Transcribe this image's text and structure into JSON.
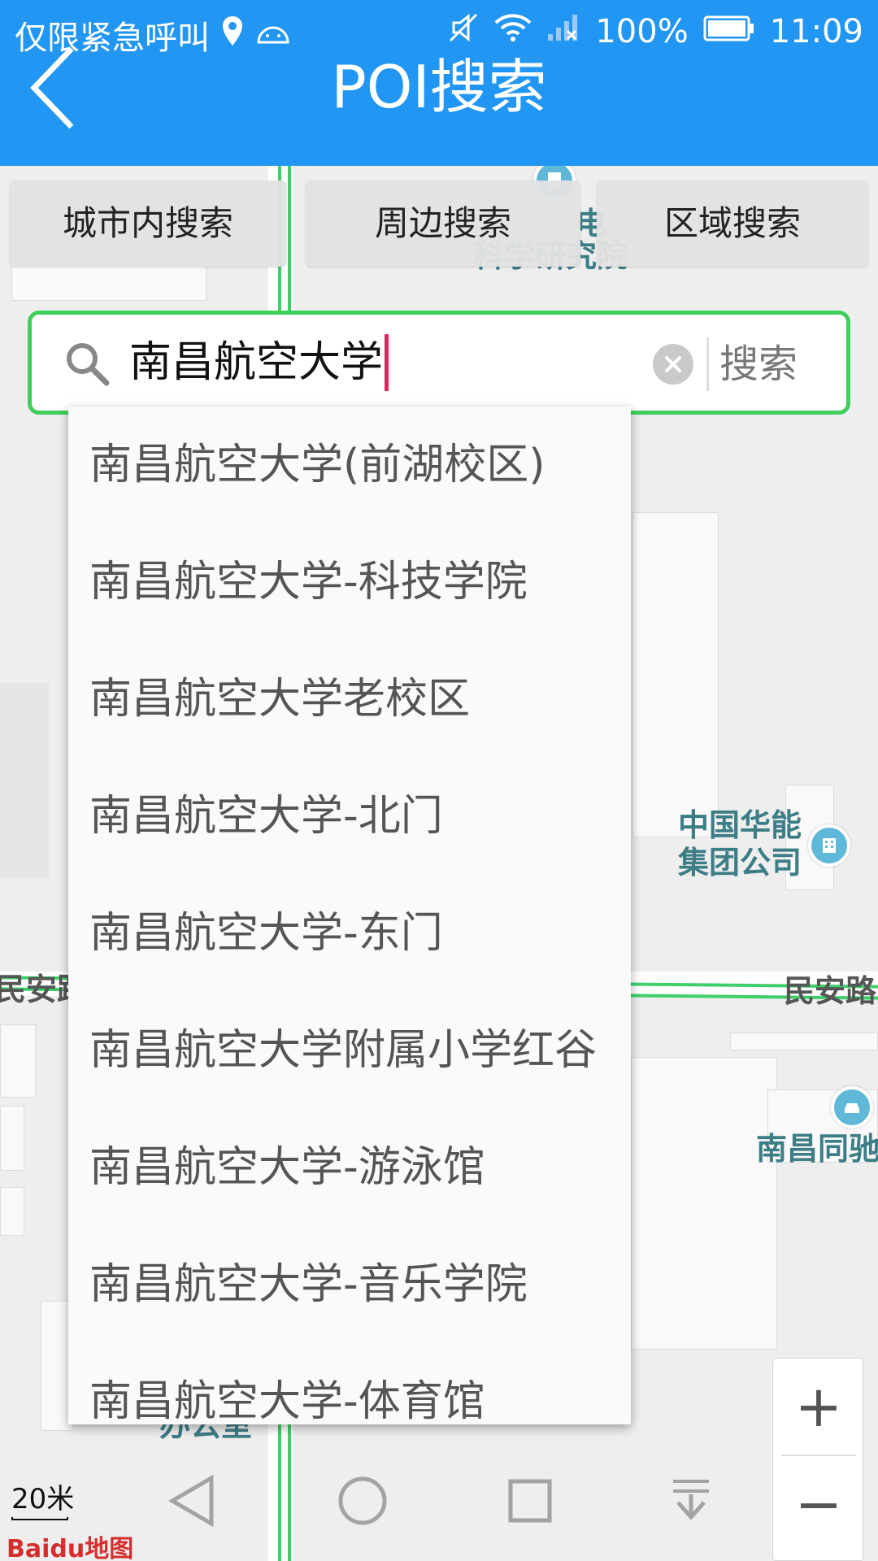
{
  "status_bar": {
    "carrier": "仅限紧急呼叫",
    "battery": "100%",
    "time": "11:09"
  },
  "header": {
    "title": "POI搜索"
  },
  "modes": [
    {
      "label": "城市内搜索"
    },
    {
      "label": "周边搜索"
    },
    {
      "label": "区域搜索"
    }
  ],
  "search": {
    "query": "南昌航空大学",
    "button_label": "搜索"
  },
  "suggestions": [
    "南昌航空大学(前湖校区)",
    "南昌航空大学-科技学院",
    "南昌航空大学老校区",
    "南昌航空大学-北门",
    "南昌航空大学-东门",
    "南昌航空大学附属小学红谷",
    "南昌航空大学-游泳馆",
    "南昌航空大学-音乐学院",
    "南昌航空大学-体育馆"
  ],
  "map": {
    "labels": {
      "research_top": "电",
      "research_bottom": "科学研究院",
      "huaneng_1": "中国华能",
      "huaneng_2": "集团公司",
      "road_left": "民安路",
      "road_right": "民安路",
      "tongchi": "南昌同驰",
      "office": "办公室"
    },
    "scale": "20米",
    "logo": "Baidu地图"
  },
  "zoom": {
    "plus": "+",
    "minus": "−"
  },
  "colors": {
    "header": "#2196f3",
    "search_border": "#3fcf5a",
    "caret": "#e0245e",
    "map_label": "#3d7d86"
  }
}
